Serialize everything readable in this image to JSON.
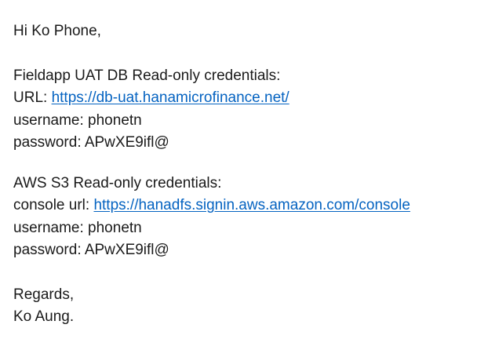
{
  "email": {
    "greeting": "Hi Ko Phone,",
    "db": {
      "heading": "Fieldapp UAT DB Read-only credentials:",
      "url_label": "URL: ",
      "url": "https://db-uat.hanamicrofinance.net/",
      "username_label": "username: ",
      "username": "phonetn",
      "password_label": "password: ",
      "password": "APwXE9ifl@"
    },
    "aws": {
      "heading": "AWS S3 Read-only credentials:",
      "url_label": "console url: ",
      "url": "https://hanadfs.signin.aws.amazon.com/console",
      "username_label": "username: ",
      "username": "phonetn",
      "password_label": "password: ",
      "password": "APwXE9ifl@"
    },
    "closing": "Regards,",
    "signature": "Ko Aung."
  },
  "colors": {
    "text": "#1a1a1a",
    "link": "#0563c1",
    "background": "#ffffff"
  }
}
